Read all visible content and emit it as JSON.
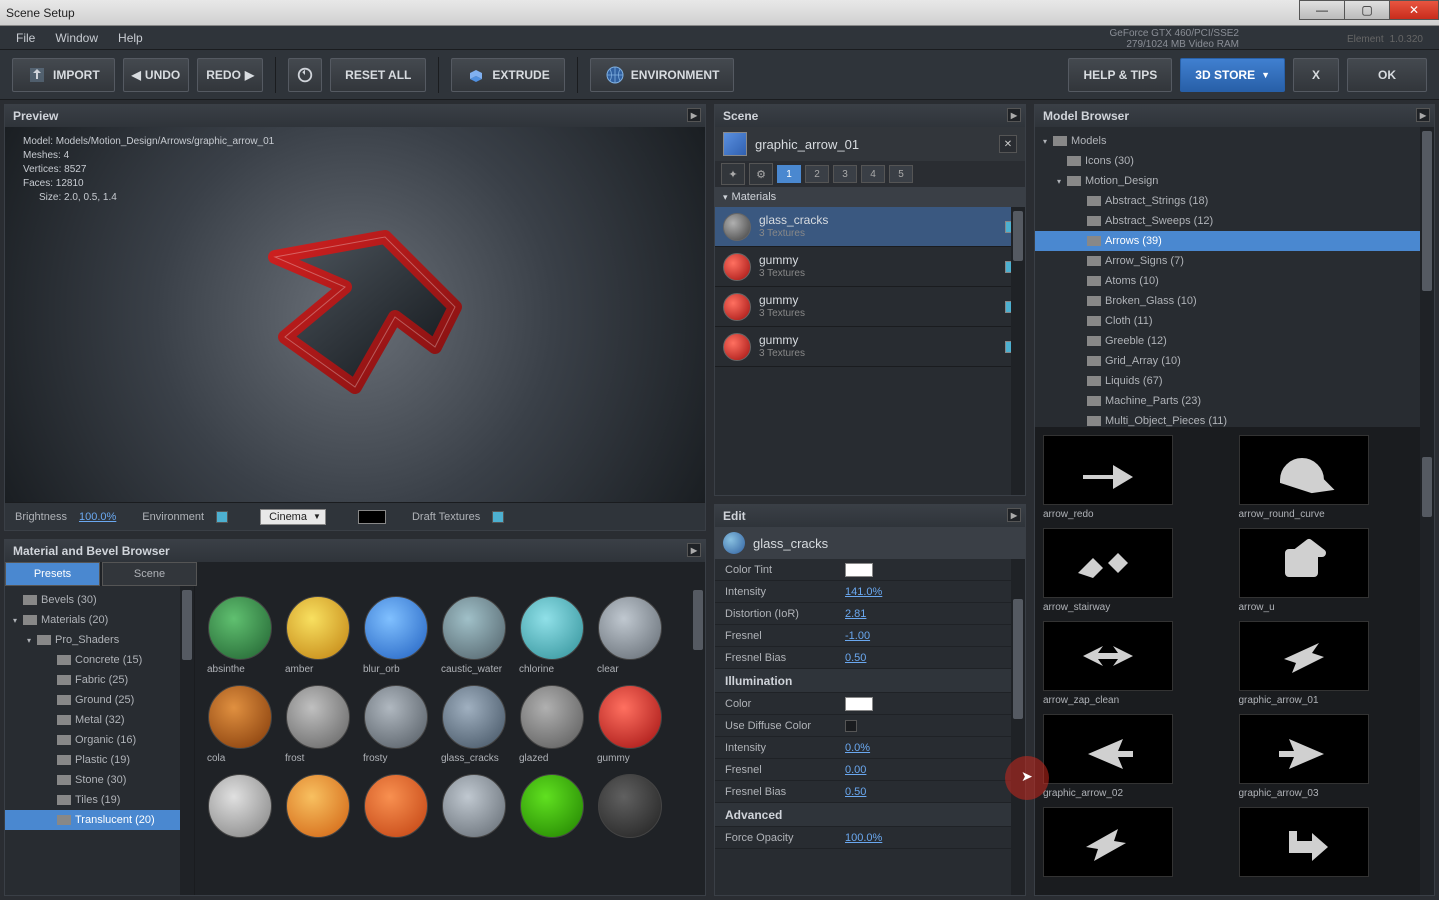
{
  "window": {
    "title": "Scene Setup"
  },
  "menubar": [
    "File",
    "Window",
    "Help"
  ],
  "gpu": {
    "line1": "GeForce GTX 460/PCI/SSE2",
    "line2": "279/1024 MB Video RAM"
  },
  "app": {
    "name": "Element",
    "version": "1.0.320"
  },
  "toolbar": {
    "import": "IMPORT",
    "undo": "UNDO",
    "redo": "REDO",
    "reset": "RESET ALL",
    "extrude": "EXTRUDE",
    "environment": "ENVIRONMENT",
    "help": "HELP & TIPS",
    "store": "3D STORE",
    "x": "X",
    "ok": "OK"
  },
  "preview": {
    "title": "Preview",
    "stats": {
      "model": "Model: Models/Motion_Design/Arrows/graphic_arrow_01",
      "meshes": "Meshes: 4",
      "vertices": "Vertices: 8527",
      "faces": "Faces: 12810",
      "size": "Size: 2.0, 0.5, 1.4"
    },
    "footer": {
      "brightness_label": "Brightness",
      "brightness_val": "100.0%",
      "environment_label": "Environment",
      "mode": "Cinema",
      "draft_label": "Draft Textures"
    }
  },
  "scene": {
    "title": "Scene",
    "object": "graphic_arrow_01",
    "tabs": [
      "1",
      "2",
      "3",
      "4",
      "5"
    ],
    "materials_label": "Materials",
    "materials": [
      {
        "name": "glass_cracks",
        "sub": "3 Textures",
        "sel": true,
        "color": "radial-gradient(circle at 35% 35%,#b0b0b0,#404040)"
      },
      {
        "name": "gummy",
        "sub": "3 Textures",
        "sel": false,
        "color": "radial-gradient(circle at 35% 35%,#ff7060,#a01010)"
      },
      {
        "name": "gummy",
        "sub": "3 Textures",
        "sel": false,
        "color": "radial-gradient(circle at 35% 35%,#ff7060,#a01010)"
      },
      {
        "name": "gummy",
        "sub": "3 Textures",
        "sel": false,
        "color": "radial-gradient(circle at 35% 35%,#ff7060,#a01010)"
      }
    ]
  },
  "edit": {
    "title": "Edit",
    "name": "glass_cracks",
    "props_top": [
      {
        "label": "Color Tint",
        "type": "swatch",
        "val": "#ffffff"
      },
      {
        "label": "Intensity",
        "type": "link",
        "val": "141.0%"
      },
      {
        "label": "Distortion (IoR)",
        "type": "link",
        "val": "2.81"
      },
      {
        "label": "Fresnel",
        "type": "link",
        "val": "-1.00"
      },
      {
        "label": "Fresnel Bias",
        "type": "link",
        "val": "0.50"
      }
    ],
    "illumination_label": "Illumination",
    "props_illum": [
      {
        "label": "Color",
        "type": "swatch",
        "val": "#ffffff"
      },
      {
        "label": "Use Diffuse Color",
        "type": "check",
        "val": false
      },
      {
        "label": "Intensity",
        "type": "link",
        "val": "0.0%"
      },
      {
        "label": "Fresnel",
        "type": "link",
        "val": "0.00"
      },
      {
        "label": "Fresnel Bias",
        "type": "link",
        "val": "0.50"
      }
    ],
    "advanced_label": "Advanced",
    "props_adv": [
      {
        "label": "Force Opacity",
        "type": "link",
        "val": "100.0%"
      }
    ]
  },
  "matBrowser": {
    "title": "Material and Bevel Browser",
    "tabs": [
      "Presets",
      "Scene"
    ],
    "tree": [
      {
        "level": 1,
        "label": "Bevels (30)",
        "arrow": ""
      },
      {
        "level": 1,
        "label": "Materials (20)",
        "arrow": "▾"
      },
      {
        "level": 2,
        "label": "Pro_Shaders",
        "arrow": "▾"
      },
      {
        "level": 3,
        "label": "Concrete (15)"
      },
      {
        "level": 3,
        "label": "Fabric (25)"
      },
      {
        "level": 3,
        "label": "Ground (25)"
      },
      {
        "level": 3,
        "label": "Metal (32)"
      },
      {
        "level": 3,
        "label": "Organic (16)"
      },
      {
        "level": 3,
        "label": "Plastic (19)"
      },
      {
        "level": 3,
        "label": "Stone (30)"
      },
      {
        "level": 3,
        "label": "Tiles (19)"
      },
      {
        "level": 3,
        "label": "Translucent (20)",
        "sel": true
      }
    ],
    "grid": [
      {
        "label": "absinthe",
        "bg": "radial-gradient(circle at 40% 35%,#60c070,#206030)"
      },
      {
        "label": "amber",
        "bg": "radial-gradient(circle at 40% 35%,#f8e060,#c08010)"
      },
      {
        "label": "blur_orb",
        "bg": "radial-gradient(circle at 40% 35%,#80c0ff,#2060c0)"
      },
      {
        "label": "caustic_water",
        "bg": "radial-gradient(circle at 40% 35%,#a0c0c8,#506068)"
      },
      {
        "label": "chlorine",
        "bg": "radial-gradient(circle at 40% 35%,#90e0e8,#309098)"
      },
      {
        "label": "clear",
        "bg": "radial-gradient(circle at 40% 35%,#c0c8d0,#606870)"
      },
      {
        "label": "cola",
        "bg": "radial-gradient(circle at 40% 35%,#e09040,#803808)"
      },
      {
        "label": "frost",
        "bg": "radial-gradient(circle at 40% 35%,#c0c0c0,#606060)"
      },
      {
        "label": "frosty",
        "bg": "radial-gradient(circle at 40% 35%,#b0b8c0,#505860)"
      },
      {
        "label": "glass_cracks",
        "bg": "radial-gradient(circle at 40% 35%,#a0b0c0,#405060)"
      },
      {
        "label": "glazed",
        "bg": "radial-gradient(circle at 40% 35%,#b0b0b0,#585858)"
      },
      {
        "label": "gummy",
        "bg": "radial-gradient(circle at 40% 35%,#ff7060,#a01010)"
      },
      {
        "label": "",
        "bg": "radial-gradient(circle at 40% 35%,#e0e0e0,#808080)"
      },
      {
        "label": "",
        "bg": "radial-gradient(circle at 40% 35%,#f8c060,#d06010)"
      },
      {
        "label": "",
        "bg": "radial-gradient(circle at 40% 35%,#f89050,#c04010)"
      },
      {
        "label": "",
        "bg": "radial-gradient(circle at 40% 35%,#c0c8d0,#606870)"
      },
      {
        "label": "",
        "bg": "radial-gradient(circle at 40% 35%,#60e020,#208000)"
      },
      {
        "label": "",
        "bg": "radial-gradient(circle at 40% 35%,#606060,#202020)"
      }
    ]
  },
  "modelBrowser": {
    "title": "Model Browser",
    "tree": [
      {
        "level": 1,
        "label": "Models",
        "arrow": "▾"
      },
      {
        "level": 2,
        "label": "Icons (30)",
        "arrow": ""
      },
      {
        "level": 2,
        "label": "Motion_Design",
        "arrow": "▾"
      },
      {
        "level": 3,
        "label": "Abstract_Strings (18)"
      },
      {
        "level": 3,
        "label": "Abstract_Sweeps (12)"
      },
      {
        "level": 3,
        "label": "Arrows (39)",
        "sel": true
      },
      {
        "level": 3,
        "label": "Arrow_Signs (7)"
      },
      {
        "level": 3,
        "label": "Atoms (10)"
      },
      {
        "level": 3,
        "label": "Broken_Glass (10)"
      },
      {
        "level": 3,
        "label": "Cloth (11)"
      },
      {
        "level": 3,
        "label": "Greeble (12)"
      },
      {
        "level": 3,
        "label": "Grid_Array (10)"
      },
      {
        "level": 3,
        "label": "Liquids (67)"
      },
      {
        "level": 3,
        "label": "Machine_Parts (23)"
      },
      {
        "level": 3,
        "label": "Multi_Object_Pieces (11)"
      }
    ],
    "models": [
      "arrow_redo",
      "arrow_round_curve",
      "arrow_stairway",
      "arrow_u",
      "arrow_zap_clean",
      "graphic_arrow_01",
      "graphic_arrow_02",
      "graphic_arrow_03",
      "",
      ""
    ]
  }
}
